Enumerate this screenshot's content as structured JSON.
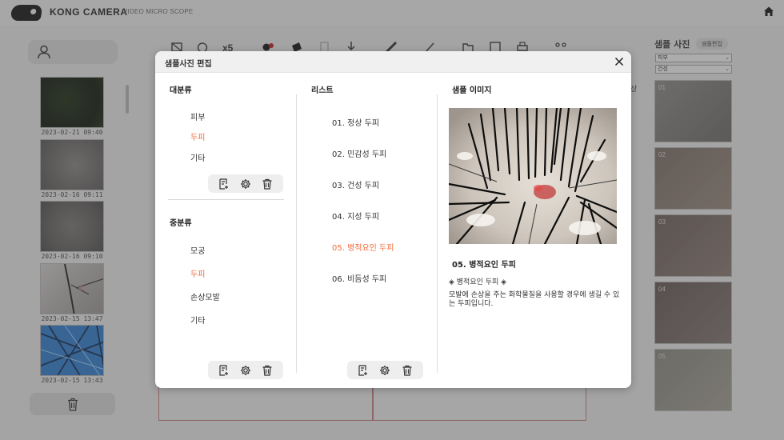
{
  "app": {
    "brand": "KONG CAMERA",
    "brand_sub": "VIDEO MICRO SCOPE"
  },
  "left_panel": {
    "thumbnails": [
      {
        "date": "2023-02-21 09:40"
      },
      {
        "date": "2023-02-16 09:11"
      },
      {
        "date": "2023-02-16 09:10"
      },
      {
        "date": "2023-02-15 13:47"
      },
      {
        "date": "2023-02-15 13:43"
      }
    ]
  },
  "background": {
    "mid_text": "상"
  },
  "right_panel": {
    "title": "샘플 사진",
    "edit_button": "샘플편집",
    "select_1": "피부",
    "select_2": "건성",
    "samples": [
      "01",
      "02",
      "03",
      "04",
      "05"
    ]
  },
  "modal": {
    "title": "샘플사진 편집",
    "major_category": {
      "heading": "대분류",
      "items": [
        {
          "label": "피부",
          "active": false
        },
        {
          "label": "두피",
          "active": true
        },
        {
          "label": "기타",
          "active": false
        }
      ]
    },
    "middle_category": {
      "heading": "중분류",
      "items": [
        {
          "label": "모공",
          "active": false
        },
        {
          "label": "두피",
          "active": true
        },
        {
          "label": "손상모발",
          "active": false
        },
        {
          "label": "기타",
          "active": false
        }
      ]
    },
    "list": {
      "heading": "리스트",
      "items": [
        {
          "label": "01. 정상 두피",
          "active": false
        },
        {
          "label": "02. 민감성 두피",
          "active": false
        },
        {
          "label": "03. 건성 두피",
          "active": false
        },
        {
          "label": "04. 지성 두피",
          "active": false
        },
        {
          "label": "05. 병적요인 두피",
          "active": true
        },
        {
          "label": "06. 비듬성 두피",
          "active": false
        }
      ]
    },
    "sample_image": {
      "heading": "샘플 이미지",
      "title": "05. 병적요인 두피",
      "tag": "◈ 병적요인 두피 ◈",
      "description": "모발에 손상을 주는 화학물질을 사용할 경우에 생길 수 있는 두피입니다."
    }
  },
  "colors": {
    "accent": "#ef6b3a",
    "overlay": "rgba(70,70,70,0.45)"
  },
  "icons": {
    "tool_add": "note-add-icon",
    "tool_settings": "gear-icon",
    "tool_delete": "trash-icon",
    "close": "close-icon",
    "home": "home-icon",
    "user": "user-icon"
  }
}
